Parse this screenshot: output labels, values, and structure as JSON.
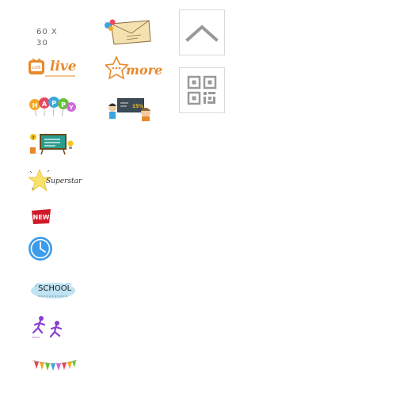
{
  "stickers": {
    "placeholder_label": "60 X 30",
    "live_label": "live",
    "live_badge": "LIVE",
    "more_label": "more",
    "happy_letters": [
      "H",
      "A",
      "P",
      "P",
      "Y"
    ],
    "board_percent": "15%",
    "superstar_label": "Superstar",
    "new_label": "NEW",
    "school_label": "SCHOOL"
  },
  "controls": {
    "scroll_top_icon": "chevron-up-icon",
    "qr_icon": "qr-code-icon"
  },
  "colors": {
    "orange": "#e8892b",
    "blue_clock": "#3d9be9",
    "purple_runner": "#8a3fd1",
    "new_red": "#d1192a",
    "border": "#d9d9d9",
    "icon_gray": "#999999"
  }
}
